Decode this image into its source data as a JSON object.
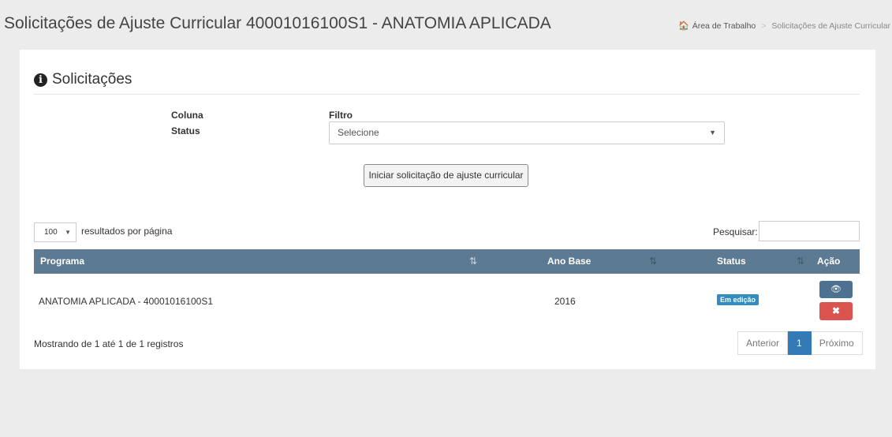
{
  "header": {
    "title": "Solicitações de Ajuste Curricular 40001016100S1 - ANATOMIA APLICADA"
  },
  "breadcrumb": {
    "home_icon": "home-icon",
    "items": [
      "Área de Trabalho",
      "Solicitações de Ajuste Curricular"
    ],
    "separator": ">"
  },
  "panel": {
    "title": "Solicitações",
    "icon": "info-circle-icon"
  },
  "filter": {
    "column_header": "Coluna",
    "filter_header": "Filtro",
    "column_name": "Status",
    "select_value": "Selecione",
    "start_button": "Iniciar solicitação de ajuste curricular"
  },
  "table_controls": {
    "page_size": "100",
    "page_size_label": "resultados por página",
    "search_label": "Pesquisar:"
  },
  "table": {
    "headers": [
      "Programa",
      "Ano Base",
      "Status",
      "Ação"
    ],
    "rows": [
      {
        "programa": "ANATOMIA APLICADA - 40001016100S1",
        "ano_base": "2016",
        "status": "Em edição",
        "status_color": "#2f8dc0"
      }
    ]
  },
  "footer": {
    "info": "Mostrando de 1 até 1 de 1 registros",
    "prev": "Anterior",
    "current_page": "1",
    "next": "Próximo"
  },
  "colors": {
    "table_header": "#5c7a92",
    "view_button": "#4e7191",
    "delete_button": "#d9534f",
    "active_page": "#337ab7"
  }
}
